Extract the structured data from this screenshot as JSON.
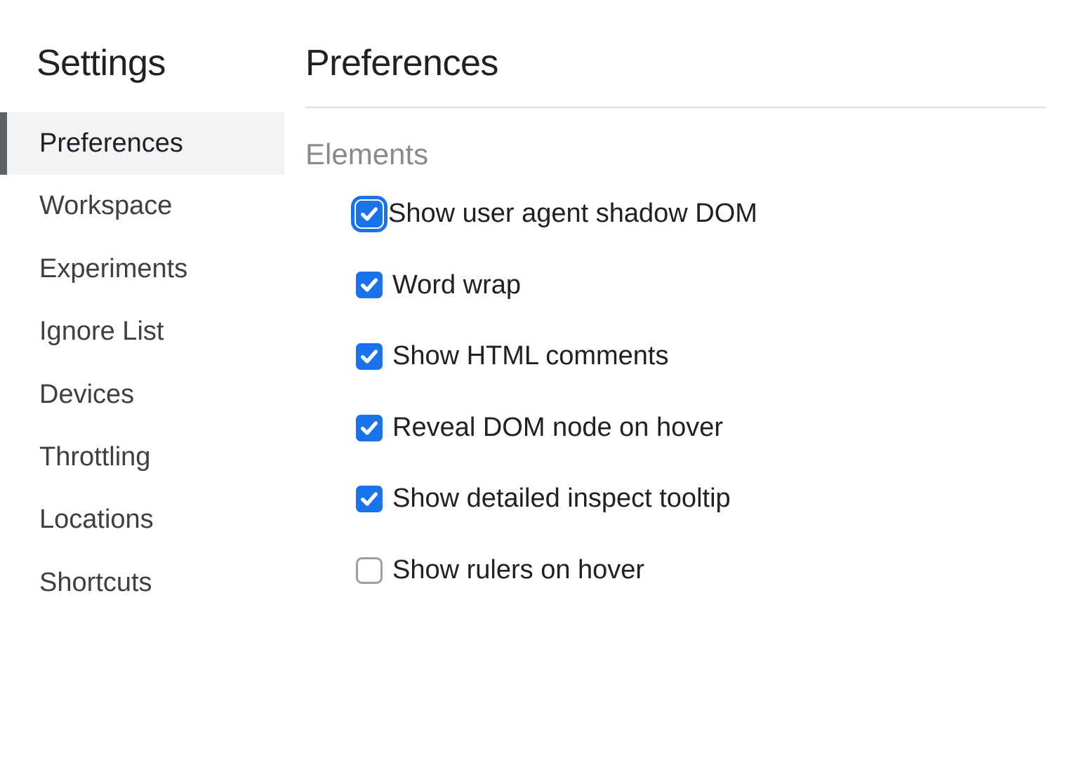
{
  "sidebar": {
    "title": "Settings",
    "items": [
      {
        "label": "Preferences",
        "active": true
      },
      {
        "label": "Workspace",
        "active": false
      },
      {
        "label": "Experiments",
        "active": false
      },
      {
        "label": "Ignore List",
        "active": false
      },
      {
        "label": "Devices",
        "active": false
      },
      {
        "label": "Throttling",
        "active": false
      },
      {
        "label": "Locations",
        "active": false
      },
      {
        "label": "Shortcuts",
        "active": false
      }
    ]
  },
  "main": {
    "title": "Preferences",
    "section": {
      "title": "Elements",
      "options": [
        {
          "label": "Show user agent shadow DOM",
          "checked": true,
          "focused": true
        },
        {
          "label": "Word wrap",
          "checked": true,
          "focused": false
        },
        {
          "label": "Show HTML comments",
          "checked": true,
          "focused": false
        },
        {
          "label": "Reveal DOM node on hover",
          "checked": true,
          "focused": false
        },
        {
          "label": "Show detailed inspect tooltip",
          "checked": true,
          "focused": false
        },
        {
          "label": "Show rulers on hover",
          "checked": false,
          "focused": false
        }
      ]
    }
  },
  "colors": {
    "accent": "#1a73e8",
    "sidebar_active_bg": "#f1f3f4",
    "sidebar_active_bar": "#5f6368",
    "section_title": "#868b90",
    "divider": "#dadce0",
    "unchecked_border": "#9aa0a6"
  }
}
